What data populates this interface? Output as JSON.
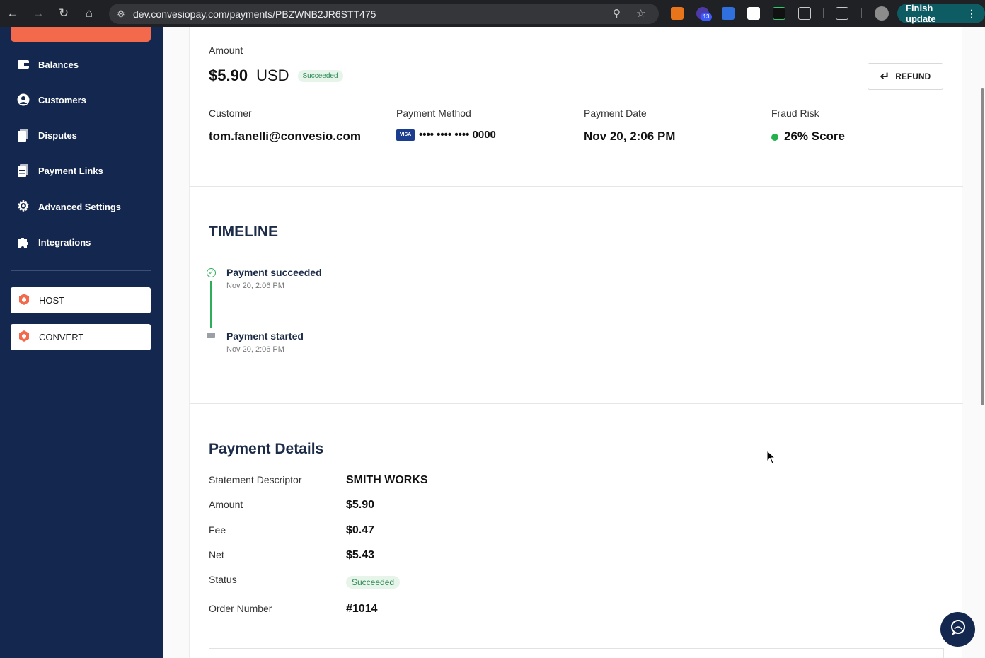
{
  "browser": {
    "url": "dev.convesiopay.com/payments/PBZWNB2JR6STT475",
    "finish_update_label": "Finish update",
    "extension_badge": "13"
  },
  "sidebar": {
    "items": [
      {
        "label": "Balances",
        "icon": "wallet-icon"
      },
      {
        "label": "Customers",
        "icon": "user-icon"
      },
      {
        "label": "Disputes",
        "icon": "document-icon"
      },
      {
        "label": "Payment Links",
        "icon": "links-icon"
      },
      {
        "label": "Advanced Settings",
        "icon": "gear-icon"
      },
      {
        "label": "Integrations",
        "icon": "puzzle-icon"
      }
    ],
    "apps": [
      {
        "label": "HOST"
      },
      {
        "label": "CONVERT"
      }
    ]
  },
  "summary": {
    "amount_label": "Amount",
    "amount_value": "$5.90",
    "currency": "USD",
    "status_badge": "Succeeded",
    "refund_label": "REFUND",
    "customer_label": "Customer",
    "customer_value": "tom.fanelli@convesio.com",
    "method_label": "Payment Method",
    "card_brand": "VISA",
    "card_number": "•••• •••• •••• 0000",
    "date_label": "Payment Date",
    "date_value": "Nov 20, 2:06 PM",
    "fraud_label": "Fraud Risk",
    "fraud_value": "26% Score"
  },
  "timeline": {
    "title": "TIMELINE",
    "events": [
      {
        "title": "Payment succeeded",
        "time": "Nov 20, 2:06 PM"
      },
      {
        "title": "Payment started",
        "time": "Nov 20, 2:06 PM"
      }
    ]
  },
  "details": {
    "title": "Payment Details",
    "rows": [
      {
        "label": "Statement Descriptor",
        "value": "SMITH WORKS"
      },
      {
        "label": "Amount",
        "value": "$5.90"
      },
      {
        "label": "Fee",
        "value": "$0.47"
      },
      {
        "label": "Net",
        "value": "$5.43"
      },
      {
        "label": "Status",
        "value": "Succeeded"
      },
      {
        "label": "Order Number",
        "value": "#1014"
      }
    ]
  },
  "colors": {
    "sidebar_bg": "#14274e",
    "accent": "#f26a4b",
    "success": "#2fae5a"
  }
}
